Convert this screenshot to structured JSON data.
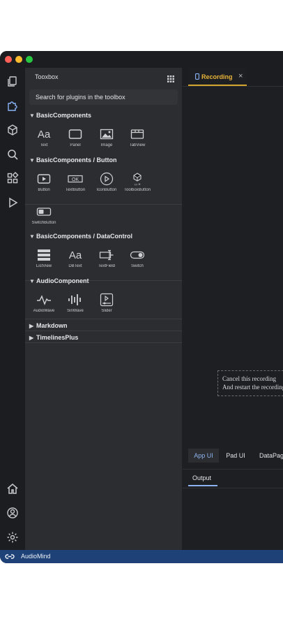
{
  "window": {
    "dots": [
      "#fe5f57",
      "#febc2e",
      "#28c840"
    ]
  },
  "toolbox": {
    "title": "Tooxbox",
    "search_placeholder": "Search for plugins in the toolbox",
    "sections": [
      {
        "title": "BasicComponents",
        "expanded": true,
        "items": [
          {
            "label": "Text",
            "icon": "text-aa-icon"
          },
          {
            "label": "Panel",
            "icon": "panel-icon"
          },
          {
            "label": "Image",
            "icon": "image-icon"
          },
          {
            "label": "TabView",
            "icon": "tabview-icon"
          }
        ]
      },
      {
        "title": "BasicComponents / Button",
        "expanded": true,
        "items": [
          {
            "label": "Button",
            "icon": "button-play-icon"
          },
          {
            "label": "TextButton",
            "icon": "ok-button-icon"
          },
          {
            "label": "IconButton",
            "icon": "icon-button-icon"
          },
          {
            "label": "ToolboxButton",
            "icon": "toolbox-button-icon"
          },
          {
            "label": "SwitchButton",
            "icon": "switch-button-icon"
          }
        ]
      },
      {
        "title": "BasicComponents / DataControl",
        "expanded": true,
        "items": [
          {
            "label": "ListView",
            "icon": "listview-icon"
          },
          {
            "label": "DBText",
            "icon": "dbtext-icon"
          },
          {
            "label": "TextField",
            "icon": "textfield-icon"
          },
          {
            "label": "Switch",
            "icon": "switch-icon"
          }
        ]
      },
      {
        "title": "AudioComponent",
        "expanded": true,
        "items": [
          {
            "label": "AudioWave",
            "icon": "audiowave-icon"
          },
          {
            "label": "SiriWave",
            "icon": "siriwave-icon"
          },
          {
            "label": "Slider",
            "icon": "slider-icon"
          }
        ]
      },
      {
        "title": "Markdown",
        "expanded": false,
        "items": []
      },
      {
        "title": "TimelinesPlus",
        "expanded": false,
        "items": []
      }
    ]
  },
  "editor": {
    "tab": {
      "label": "Recording"
    },
    "dialog": {
      "line1": "Cancel this recording",
      "line2": "And restart the recording"
    },
    "ui_tabs": [
      {
        "label": "App UI",
        "active": true
      },
      {
        "label": "Pad UI",
        "active": false
      },
      {
        "label": "DataPage",
        "active": false
      }
    ],
    "output_label": "Output"
  },
  "status": {
    "label": "AudioMind"
  },
  "colors": {
    "accent_tab": "#d4a72c",
    "status_bar": "#1e4277",
    "output_underline": "#8eb4f0"
  }
}
